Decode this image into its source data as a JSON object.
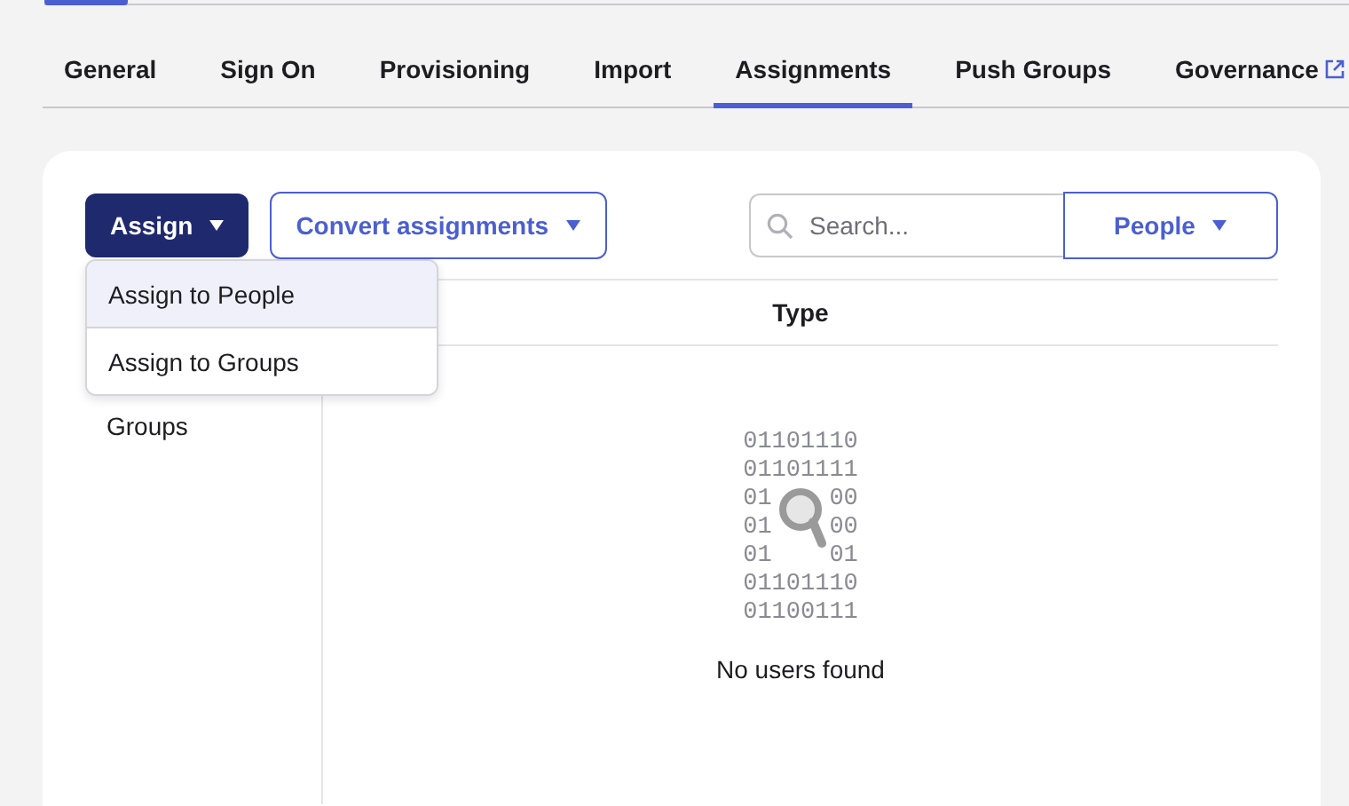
{
  "tabs": [
    {
      "label": "General",
      "selected": false,
      "external": false
    },
    {
      "label": "Sign On",
      "selected": false,
      "external": false
    },
    {
      "label": "Provisioning",
      "selected": false,
      "external": false
    },
    {
      "label": "Import",
      "selected": false,
      "external": false
    },
    {
      "label": "Assignments",
      "selected": true,
      "external": false
    },
    {
      "label": "Push Groups",
      "selected": false,
      "external": false
    },
    {
      "label": "Governance",
      "selected": false,
      "external": true
    }
  ],
  "toolbar": {
    "assign_button": {
      "label": "Assign",
      "menu_open": true,
      "menu": [
        {
          "label": "Assign to People",
          "selected": true
        },
        {
          "label": "Assign to Groups",
          "selected": false
        }
      ]
    },
    "convert_button": {
      "label": "Convert assignments"
    },
    "search": {
      "placeholder": "Search..."
    },
    "filter": {
      "label": "People"
    }
  },
  "filter_list": {
    "items": [
      "Groups"
    ]
  },
  "table": {
    "columns": [
      "Type"
    ]
  },
  "empty_state": {
    "binary": [
      [
        "01101110"
      ],
      [
        "01101111"
      ],
      [
        "01",
        "00"
      ],
      [
        "01",
        "00"
      ],
      [
        "01",
        "01"
      ],
      [
        "01101110"
      ],
      [
        "01100111"
      ]
    ],
    "message": "No users found"
  }
}
